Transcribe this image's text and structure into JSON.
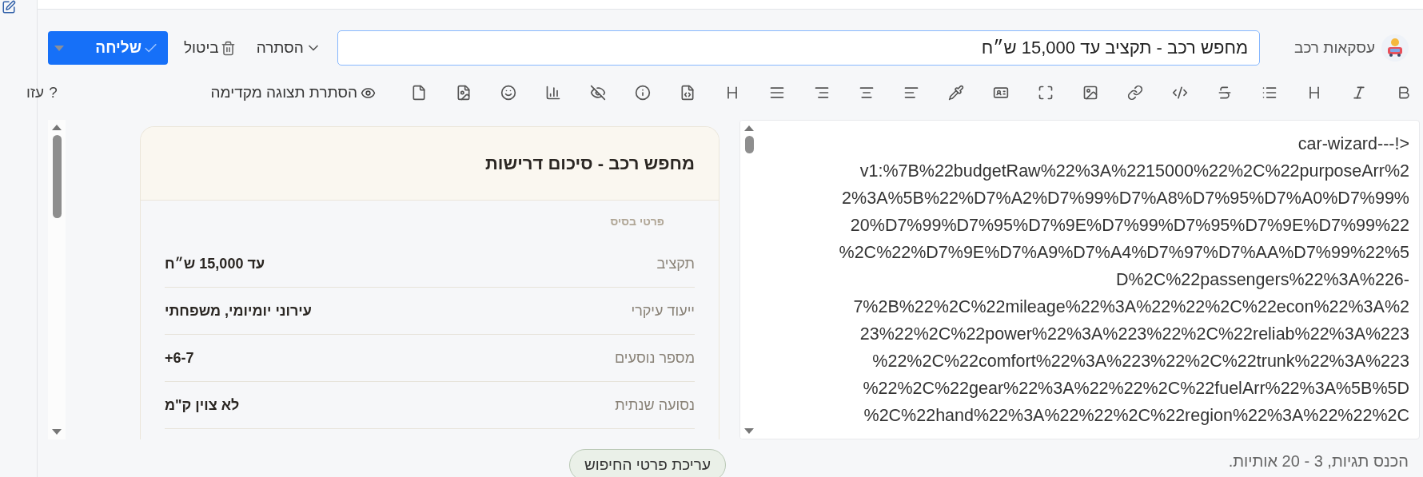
{
  "header": {
    "account_name": "עסקאות רכב",
    "title_value": "מחפש רכב - תקציב עד 15,000 ש״ח",
    "buttons": [
      {
        "kind": "toggle",
        "label": "הסתרה"
      },
      {
        "kind": "delete",
        "label": "ביטול"
      },
      {
        "kind": "send",
        "label": "שליחה"
      }
    ]
  },
  "toolbar": {
    "preview_toggle": "הסתרת תצוגה מקדימה",
    "help_icon": "?",
    "help_label": "עזו"
  },
  "editor": {
    "lines": [
      "car-wizard---!>",
      "v1:%7B%22budgetRaw%22%3A%2215000%22%2C%22purposeArr%2",
      "2%3A%5B%22%D7%A2%D7%99%D7%A8%D7%95%D7%A0%D7%99%",
      "20%D7%99%D7%95%D7%9E%D7%99%D7%95%D7%9E%D7%99%22",
      "%2C%22%D7%9E%D7%A9%D7%A4%D7%97%D7%AA%D7%99%22%5",
      "D%2C%22passengers%22%3A%226-",
      "7%2B%22%2C%22mileage%22%3A%22%22%2C%22econ%22%3A%2",
      "23%22%2C%22power%22%3A%223%22%2C%22reliab%22%3A%223",
      "%22%2C%22comfort%22%3A%223%22%2C%22trunk%22%3A%223",
      "%22%2C%22gear%22%3A%22%22%2C%22fuelArr%22%3A%5B%5D",
      "%2C%22hand%22%3A%22%22%2C%22region%22%3A%22%22%2C"
    ]
  },
  "preview": {
    "title": "מחפש רכב - סיכום דרישות",
    "section": "פרטי בסיס",
    "rows": [
      {
        "label": "תקציב",
        "value": "עד 15,000 ש״ח"
      },
      {
        "label": "ייעוד עיקרי",
        "value": "עירוני יומיומי, משפחתי"
      },
      {
        "label": "מספר נוסעים",
        "value": "+6-7"
      },
      {
        "label": "נסועה שנתית",
        "value": "לא צוין ק\"מ"
      }
    ]
  },
  "tags_hint": "הכנס תגיות, 3 - 20 אותיות.",
  "floating_button": "עריכת פרטי החיפוש"
}
